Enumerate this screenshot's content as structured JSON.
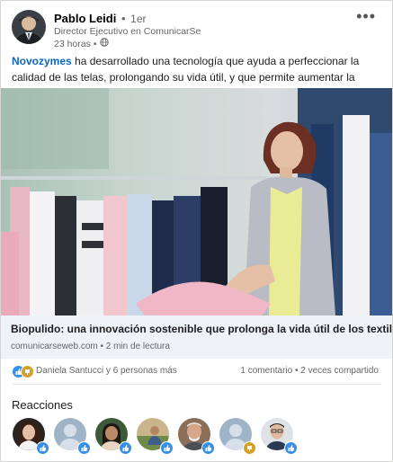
{
  "post": {
    "author_name": "Pablo Leidi",
    "degree": "1er",
    "author_title": "Director Ejecutivo en ComunicarSe",
    "time": "23 horas",
    "menu_label": "•••",
    "text_company": "Novozymes",
    "text_rest": " ha desarrollado una tecnología que ayuda a perfeccionar la calidad de las telas, prolongando su vida útil, y que permite aumentar la circularidad."
  },
  "link": {
    "title": "Biopulido: una innovación sostenible que prolonga la vida útil de los textiles",
    "domain": "comunicarseweb.com",
    "read_time": "2 min de lectura"
  },
  "social": {
    "names": "Daniela Santucci y 6 personas más",
    "comments": "1 comentario",
    "shares": "2 veces compartido"
  },
  "reactions": {
    "title": "Reacciones",
    "reactors": [
      {
        "avatar": "woman-dark-hair",
        "reaction": "like-icon"
      },
      {
        "avatar": "default-person",
        "reaction": "like-icon"
      },
      {
        "avatar": "woman-smiling",
        "reaction": "like-icon"
      },
      {
        "avatar": "person-outdoors",
        "reaction": "like-icon"
      },
      {
        "avatar": "man-older",
        "reaction": "like-icon"
      },
      {
        "avatar": "default-person",
        "reaction": "celebrate-icon"
      },
      {
        "avatar": "man-glasses",
        "reaction": "like-icon"
      }
    ]
  },
  "colors": {
    "link_blue": "#0a66c2",
    "like_blue": "#378fe9",
    "celebrate_gold": "#d7a02b"
  }
}
